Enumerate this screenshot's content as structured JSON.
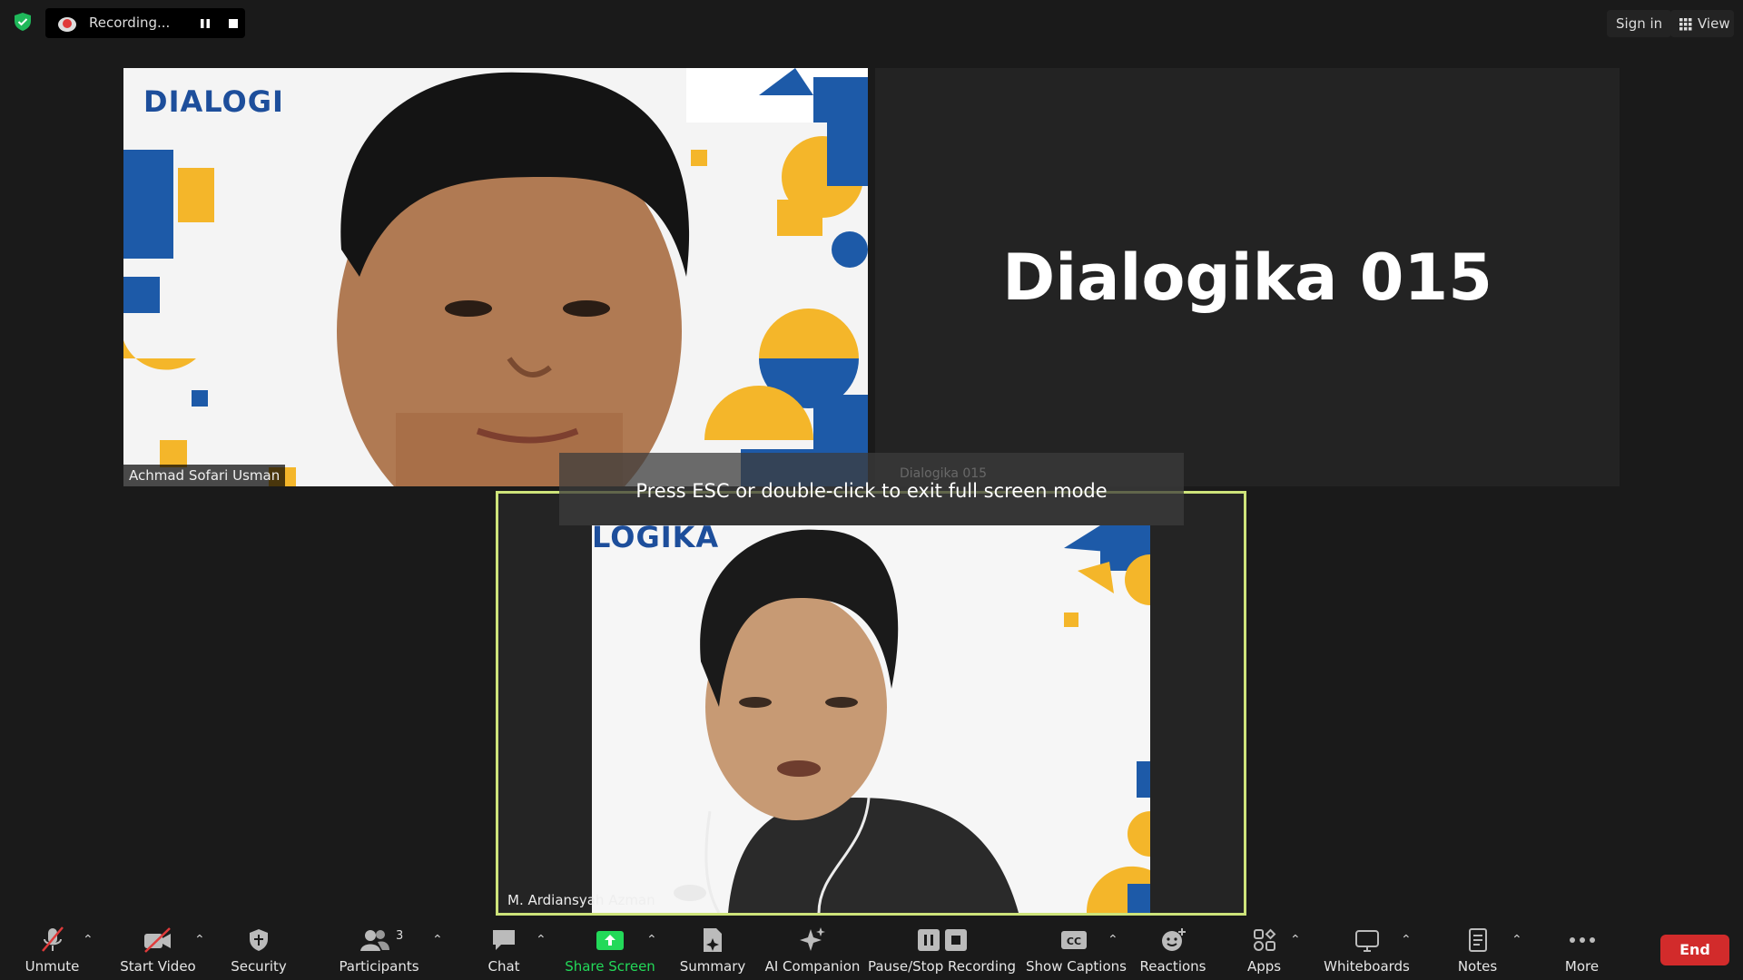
{
  "topbar": {
    "recording_label": "Recording...",
    "signin_label": "Sign in",
    "view_label": "View"
  },
  "tiles": [
    {
      "participant_name": "Achmad Sofari Usman",
      "logo_text": "DIALOGI"
    },
    {
      "slide_title": "Dialogika 015"
    },
    {
      "participant_name": "M. Ardiansyah Azman",
      "logo_text": "LOGIKA"
    }
  ],
  "overlay": {
    "esc_message": "Press ESC or double-click to exit full screen mode",
    "ghost_meeting_name": "Dialogika 015"
  },
  "toolbar": {
    "unmute": "Unmute",
    "start_video": "Start Video",
    "security": "Security",
    "participants": "Participants",
    "participants_count": "3",
    "chat": "Chat",
    "share_screen": "Share Screen",
    "summary": "Summary",
    "ai_companion": "AI Companion",
    "pause_stop_recording": "Pause/Stop Recording",
    "show_captions": "Show Captions",
    "reactions": "Reactions",
    "apps": "Apps",
    "whiteboards": "Whiteboards",
    "notes": "Notes",
    "more": "More",
    "end": "End"
  },
  "colors": {
    "background": "#1a1a1a",
    "active_speaker_border": "#cde37a",
    "share_screen_green": "#23d959",
    "end_red": "#d22b2b",
    "security_shield_green": "#1fb85a"
  },
  "icons": [
    "shield-icon",
    "record-icon",
    "pause-icon",
    "stop-icon",
    "grid-icon",
    "mic-muted-icon",
    "video-off-icon",
    "security-shield-icon",
    "participants-icon",
    "chat-icon",
    "share-screen-icon",
    "summary-icon",
    "sparkle-icon",
    "pause-stop-icon",
    "cc-icon",
    "reactions-icon",
    "apps-icon",
    "whiteboard-icon",
    "notes-icon",
    "more-icon"
  ]
}
